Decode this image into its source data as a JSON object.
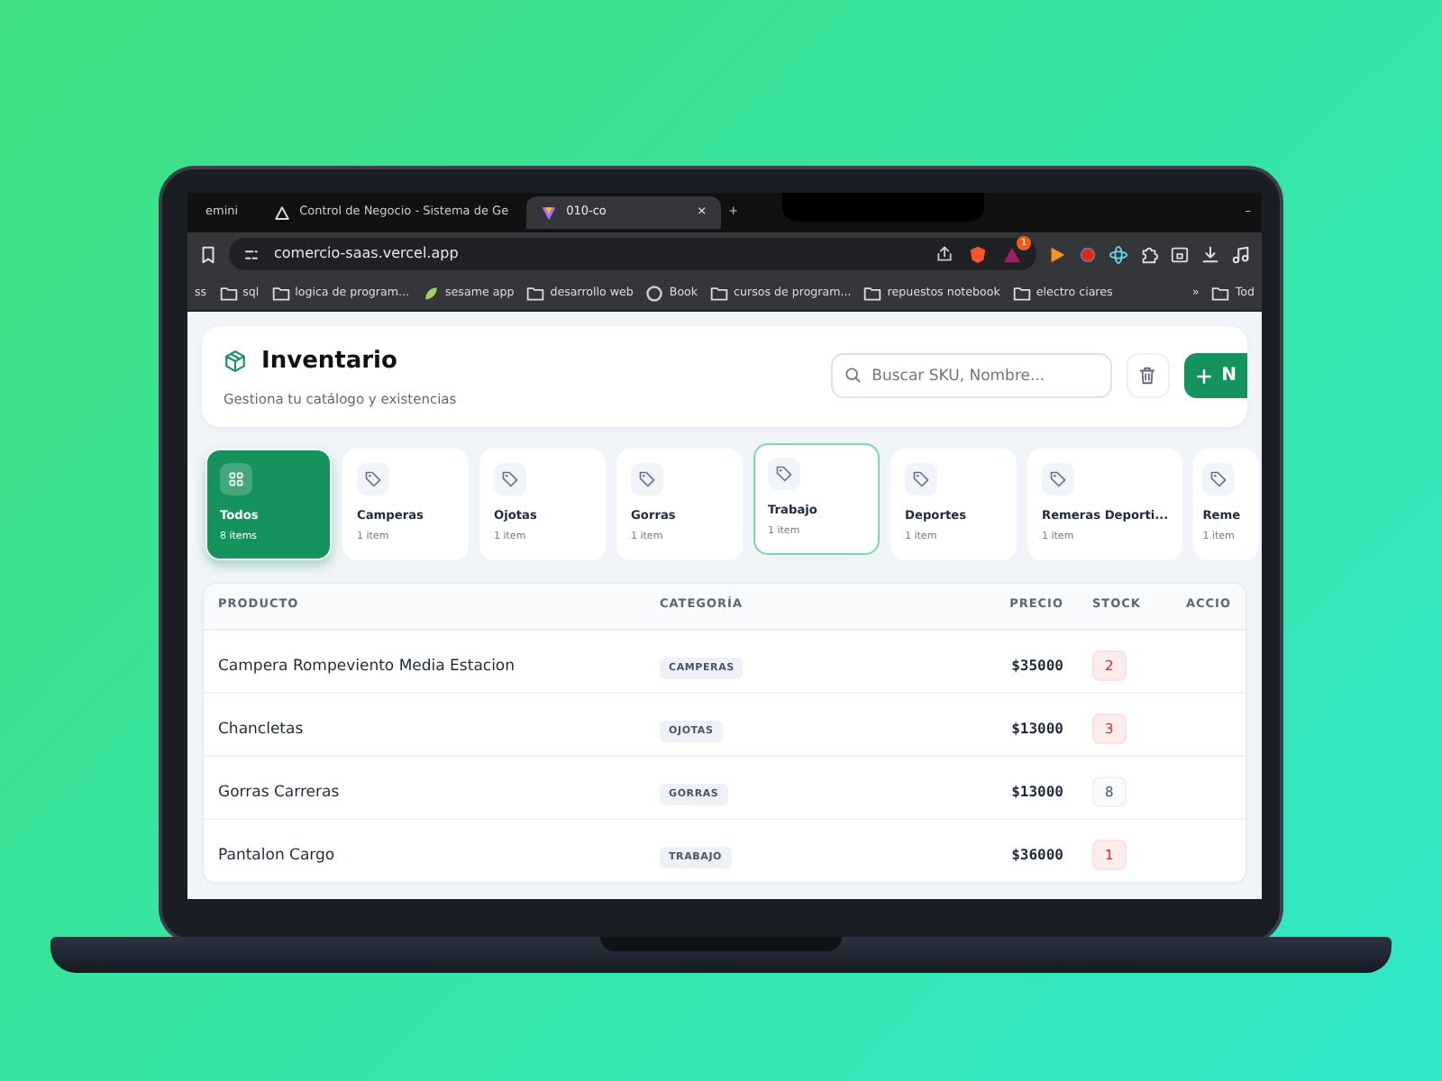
{
  "browser": {
    "tabs": [
      {
        "label": "emini",
        "selected": false
      },
      {
        "label": "Control de Negocio - Sistema de Ge",
        "selected": false
      },
      {
        "label": "010-co",
        "selected": true
      }
    ],
    "new_tab": "+",
    "minimize": "–",
    "close_tab": "×",
    "address": "comercio-saas.vercel.app",
    "extension_badge": "1",
    "bookmarks": [
      {
        "label": "ss",
        "kind": "text"
      },
      {
        "label": "sql",
        "kind": "folder"
      },
      {
        "label": "logica de program...",
        "kind": "folder"
      },
      {
        "label": "sesame app",
        "kind": "leaf"
      },
      {
        "label": "desarrollo web",
        "kind": "folder"
      },
      {
        "label": "Book",
        "kind": "circle"
      },
      {
        "label": "cursos de program...",
        "kind": "folder"
      },
      {
        "label": "repuestos notebook",
        "kind": "folder"
      },
      {
        "label": "electro ciares",
        "kind": "folder"
      },
      {
        "label": "»",
        "kind": "text"
      },
      {
        "label": "Tod",
        "kind": "folder"
      }
    ]
  },
  "header": {
    "title": "Inventario",
    "subtitle": "Gestiona tu catálogo y existencias",
    "search": {
      "placeholder": "Buscar SKU, Nombre..."
    },
    "new_button": "N"
  },
  "categories": [
    {
      "name": "Todos",
      "count": "8 items",
      "kind": "all",
      "selected": true,
      "hovered": false
    },
    {
      "name": "Camperas",
      "count": "1 item",
      "kind": "tag",
      "selected": false,
      "hovered": false
    },
    {
      "name": "Ojotas",
      "count": "1 item",
      "kind": "tag",
      "selected": false,
      "hovered": false
    },
    {
      "name": "Gorras",
      "count": "1 item",
      "kind": "tag",
      "selected": false,
      "hovered": false
    },
    {
      "name": "Trabajo",
      "count": "1 item",
      "kind": "tag",
      "selected": false,
      "hovered": true
    },
    {
      "name": "Deportes",
      "count": "1 item",
      "kind": "tag",
      "selected": false,
      "hovered": false
    },
    {
      "name": "Remeras Deporti...",
      "count": "1 item",
      "kind": "tag",
      "selected": false,
      "hovered": false
    },
    {
      "name": "Reme",
      "count": "1 item",
      "kind": "tag",
      "selected": false,
      "hovered": false
    }
  ],
  "table": {
    "columns": [
      "PRODUCTO",
      "CATEGORÍA",
      "PRECIO",
      "STOCK",
      "ACCIO"
    ],
    "rows": [
      {
        "product": "Campera Rompeviento Media Estacion",
        "category": "CAMPERAS",
        "price": "$35000",
        "stock": "2",
        "low": true
      },
      {
        "product": "Chancletas",
        "category": "OJOTAS",
        "price": "$13000",
        "stock": "3",
        "low": true
      },
      {
        "product": "Gorras Carreras",
        "category": "GORRAS",
        "price": "$13000",
        "stock": "8",
        "low": false
      },
      {
        "product": "Pantalon Cargo",
        "category": "TRABAJO",
        "price": "$36000",
        "stock": "1",
        "low": true
      }
    ]
  }
}
